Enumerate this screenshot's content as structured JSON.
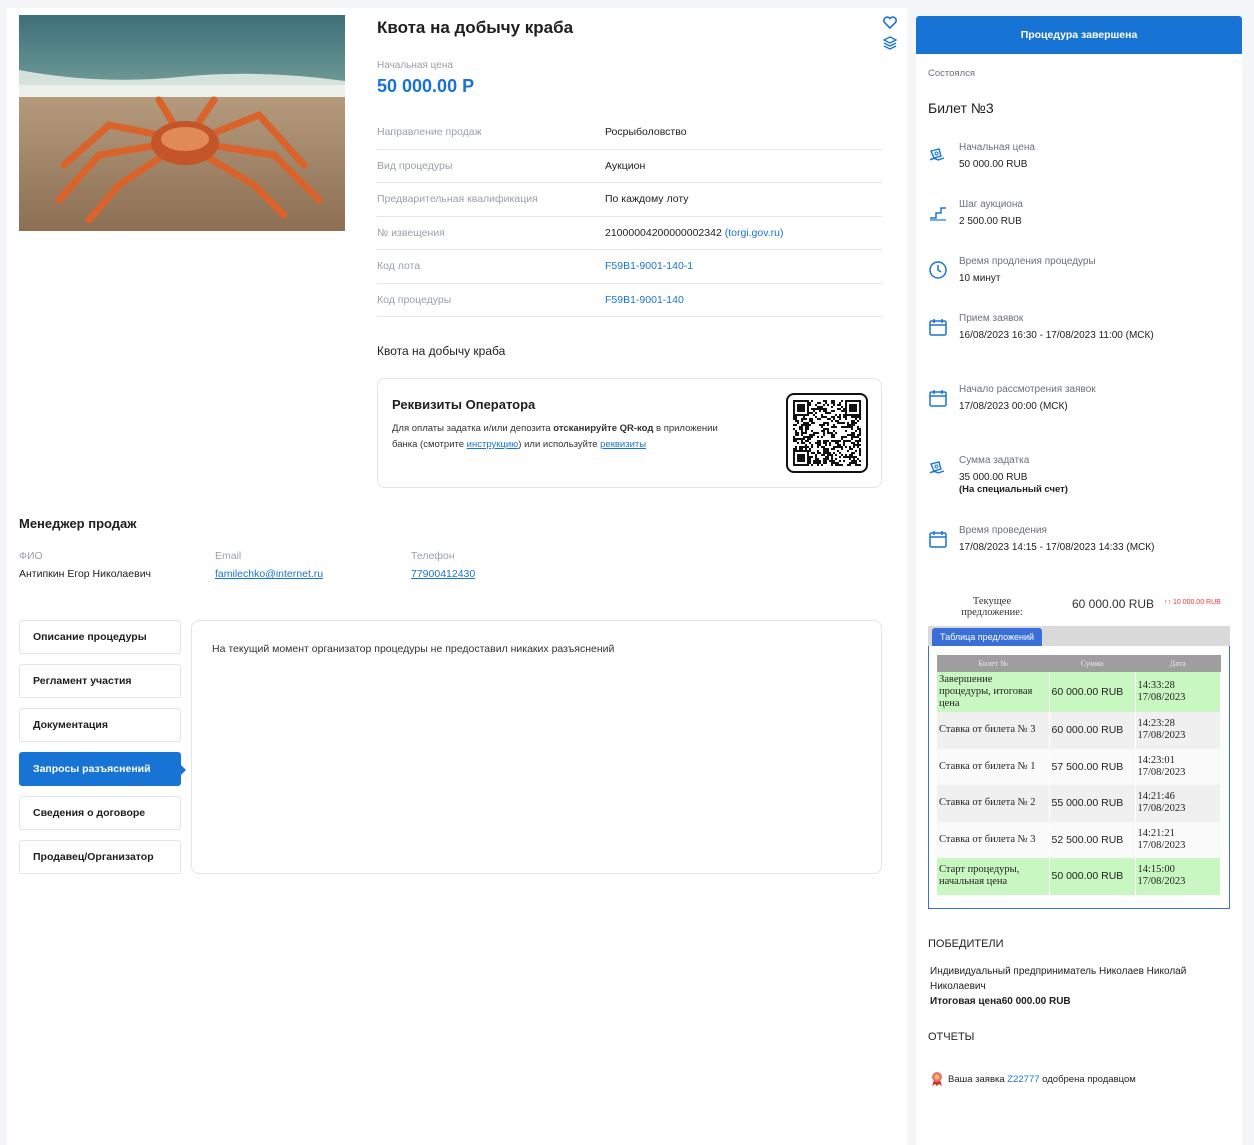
{
  "lot": {
    "title": "Квота на добычу краба",
    "price_label": "Начальная цена",
    "price_value": "50 000.00 Р",
    "description": "Квота на добычу краба",
    "info": [
      {
        "key": "Направление продаж",
        "value": "Росрыболовство"
      },
      {
        "key": "Вид процедуры",
        "value": "Аукцион"
      },
      {
        "key": "Предварительная квалификация",
        "value": "По каждому лоту"
      },
      {
        "key": "№ извещения",
        "value": "21000004200000002342",
        "paren": "(torgi.gov.ru)"
      },
      {
        "key": "Код лота",
        "value": "F59B1-9001-140-1"
      },
      {
        "key": "Код процедуры",
        "value": "F59B1-9001-140"
      }
    ]
  },
  "requisites": {
    "title": "Реквизиты Оператора",
    "text_1": "Для оплаты задатка и/или депозита ",
    "text_bold": "отсканируйте QR-код",
    "text_2": " в приложении банка (смотрите ",
    "instr_link": "инструкцию",
    "text_3": ") или используйте ",
    "req_link": "реквизиты"
  },
  "manager": {
    "title": "Менеджер продаж",
    "name_label": "ФИО",
    "name": "Антипкин Егор Николаевич",
    "email_label": "Email",
    "email": "familechko@internet.ru",
    "phone_label": "Телефон",
    "phone": "77900412430"
  },
  "tabs": [
    {
      "label": "Описание процедуры",
      "active": false
    },
    {
      "label": "Регламент участия",
      "active": false
    },
    {
      "label": "Документация",
      "active": false
    },
    {
      "label": "Запросы разъяснений",
      "active": true
    },
    {
      "label": "Сведения о договоре",
      "active": false
    },
    {
      "label": "Продавец/Организатор",
      "active": false
    }
  ],
  "tab_message": "На текущий момент организатор процедуры не предоставил никаких разъяснений",
  "side": {
    "status": "Процедура завершена",
    "status_sub": "Состоялся",
    "ticket": "Билет №3",
    "params": [
      {
        "icon": "money-hand-icon",
        "label": "Начальная цена",
        "value": "50 000.00 RUB"
      },
      {
        "icon": "step-icon",
        "label": "Шаг аукциона",
        "value": "2 500.00 RUB"
      },
      {
        "icon": "clock-icon",
        "label": "Время продления процедуры",
        "value": "10 минут"
      },
      {
        "icon": "calendar-icon",
        "label": "Прием заявок",
        "value": "16/08/2023 16:30 - 17/08/2023 11:00 (МСК)"
      },
      {
        "icon": "calendar-icon",
        "label": "Начало рассмотрения заявок",
        "value": "17/08/2023 00:00 (МСК)"
      },
      {
        "icon": "money-hand-icon",
        "label": "Сумма задатка",
        "value": "35 000.00 RUB",
        "note": "(На специальный счет)"
      },
      {
        "icon": "calendar-icon",
        "label": "Время проведения",
        "value": "17/08/2023 14:15 - 17/08/2023 14:33 (МСК)"
      }
    ],
    "current_offer": {
      "label": "Текущее предложение:",
      "value": "60 000.00 RUB",
      "delta": "↑↑ 10 000.00 RUB"
    },
    "offers_tab": "Таблица предложений",
    "offers_headers": [
      "Билет №",
      "Сумма",
      "Дата"
    ],
    "offers_rows": [
      {
        "ticket": "Завершение процедуры, итоговая цена",
        "sum": "60 000.00 RUB",
        "time": "14:33:28",
        "date": "17/08/2023",
        "style": "green"
      },
      {
        "ticket": "Ставка от билета № 3",
        "sum": "60 000.00 RUB",
        "time": "14:23:28",
        "date": "17/08/2023",
        "style": "grey"
      },
      {
        "ticket": "Ставка от билета № 1",
        "sum": "57 500.00 RUB",
        "time": "14:23:01",
        "date": "17/08/2023",
        "style": "white"
      },
      {
        "ticket": "Ставка от билета № 2",
        "sum": "55 000.00 RUB",
        "time": "14:21:46",
        "date": "17/08/2023",
        "style": "grey"
      },
      {
        "ticket": "Ставка от билета № 3",
        "sum": "52 500.00 RUB",
        "time": "14:21:21",
        "date": "17/08/2023",
        "style": "white"
      },
      {
        "ticket": "Старт процедуры, начальная цена",
        "sum": "50 000.00 RUB",
        "time": "14:15:00",
        "date": "17/08/2023",
        "style": "green"
      }
    ],
    "winners_title": "ПОБЕДИТЕЛИ",
    "winners_text": "Индивидуальный предприниматель Николаев Николай Николаевич",
    "winners_price_label": "Итоговая цена",
    "winners_price": "60 000.00 RUB",
    "reports_title": "ОТЧЕТЫ",
    "report_text_1": "Ваша заявка ",
    "report_id": "Z22777",
    "report_text_2": " одобрена продавцом"
  },
  "colors": {
    "accent": "#1874d4",
    "offer_green": "#c9f7c1",
    "delta_red": "#e53935"
  }
}
